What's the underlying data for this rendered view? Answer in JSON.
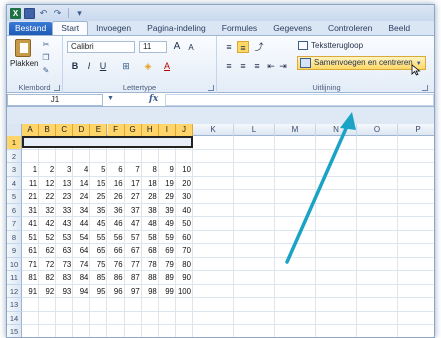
{
  "quick_access": {
    "icons": [
      "excel-icon",
      "save-icon",
      "undo-icon",
      "redo-icon",
      "customize-icon"
    ]
  },
  "tabs": [
    "Bestand",
    "Start",
    "Invoegen",
    "Pagina-indeling",
    "Formules",
    "Gegevens",
    "Controleren",
    "Beeld"
  ],
  "ribbon": {
    "clipboard": {
      "paste_label": "Plakken",
      "group_label": "Klembord"
    },
    "font": {
      "font_name": "Calibri",
      "font_size": "11",
      "grow": "A",
      "shrink": "A",
      "bold": "B",
      "italic": "I",
      "underline": "U",
      "font_color": "A",
      "group_label": "Lettertype"
    },
    "alignment": {
      "wrap_label": "Tekstterugloop",
      "merge_label": "Samenvoegen en centreren",
      "group_label": "Uitlijning"
    }
  },
  "formula_bar": {
    "name_box": "J1",
    "fx": "fx",
    "formula": ""
  },
  "sheet": {
    "columns": [
      "A",
      "B",
      "C",
      "D",
      "E",
      "F",
      "G",
      "H",
      "I",
      "J",
      "K",
      "L",
      "M",
      "N",
      "O",
      "P"
    ],
    "rows": [
      "1",
      "2",
      "3",
      "4",
      "5",
      "6",
      "7",
      "8",
      "9",
      "10",
      "11",
      "12",
      "13",
      "14",
      "15"
    ],
    "data": [
      [
        "1",
        "2",
        "3",
        "4",
        "5",
        "6",
        "7",
        "8",
        "9",
        "10"
      ],
      [
        "11",
        "12",
        "13",
        "14",
        "15",
        "16",
        "17",
        "18",
        "19",
        "20"
      ],
      [
        "21",
        "22",
        "23",
        "24",
        "25",
        "26",
        "27",
        "28",
        "29",
        "30"
      ],
      [
        "31",
        "32",
        "33",
        "34",
        "35",
        "36",
        "37",
        "38",
        "39",
        "40"
      ],
      [
        "41",
        "42",
        "43",
        "44",
        "45",
        "46",
        "47",
        "48",
        "49",
        "50"
      ],
      [
        "51",
        "52",
        "53",
        "54",
        "55",
        "56",
        "57",
        "58",
        "59",
        "60"
      ],
      [
        "61",
        "62",
        "63",
        "64",
        "65",
        "66",
        "67",
        "68",
        "69",
        "70"
      ],
      [
        "71",
        "72",
        "73",
        "74",
        "75",
        "76",
        "77",
        "78",
        "79",
        "80"
      ],
      [
        "81",
        "82",
        "83",
        "84",
        "85",
        "86",
        "87",
        "88",
        "89",
        "90"
      ],
      [
        "91",
        "92",
        "93",
        "94",
        "95",
        "96",
        "97",
        "98",
        "99",
        "100"
      ]
    ],
    "data_start_row": 3,
    "selected_range": "A1:J1"
  },
  "colors": {
    "accent": "#ffd56a",
    "arrow": "#1aa3c4",
    "file_tab": "#2b579a"
  }
}
